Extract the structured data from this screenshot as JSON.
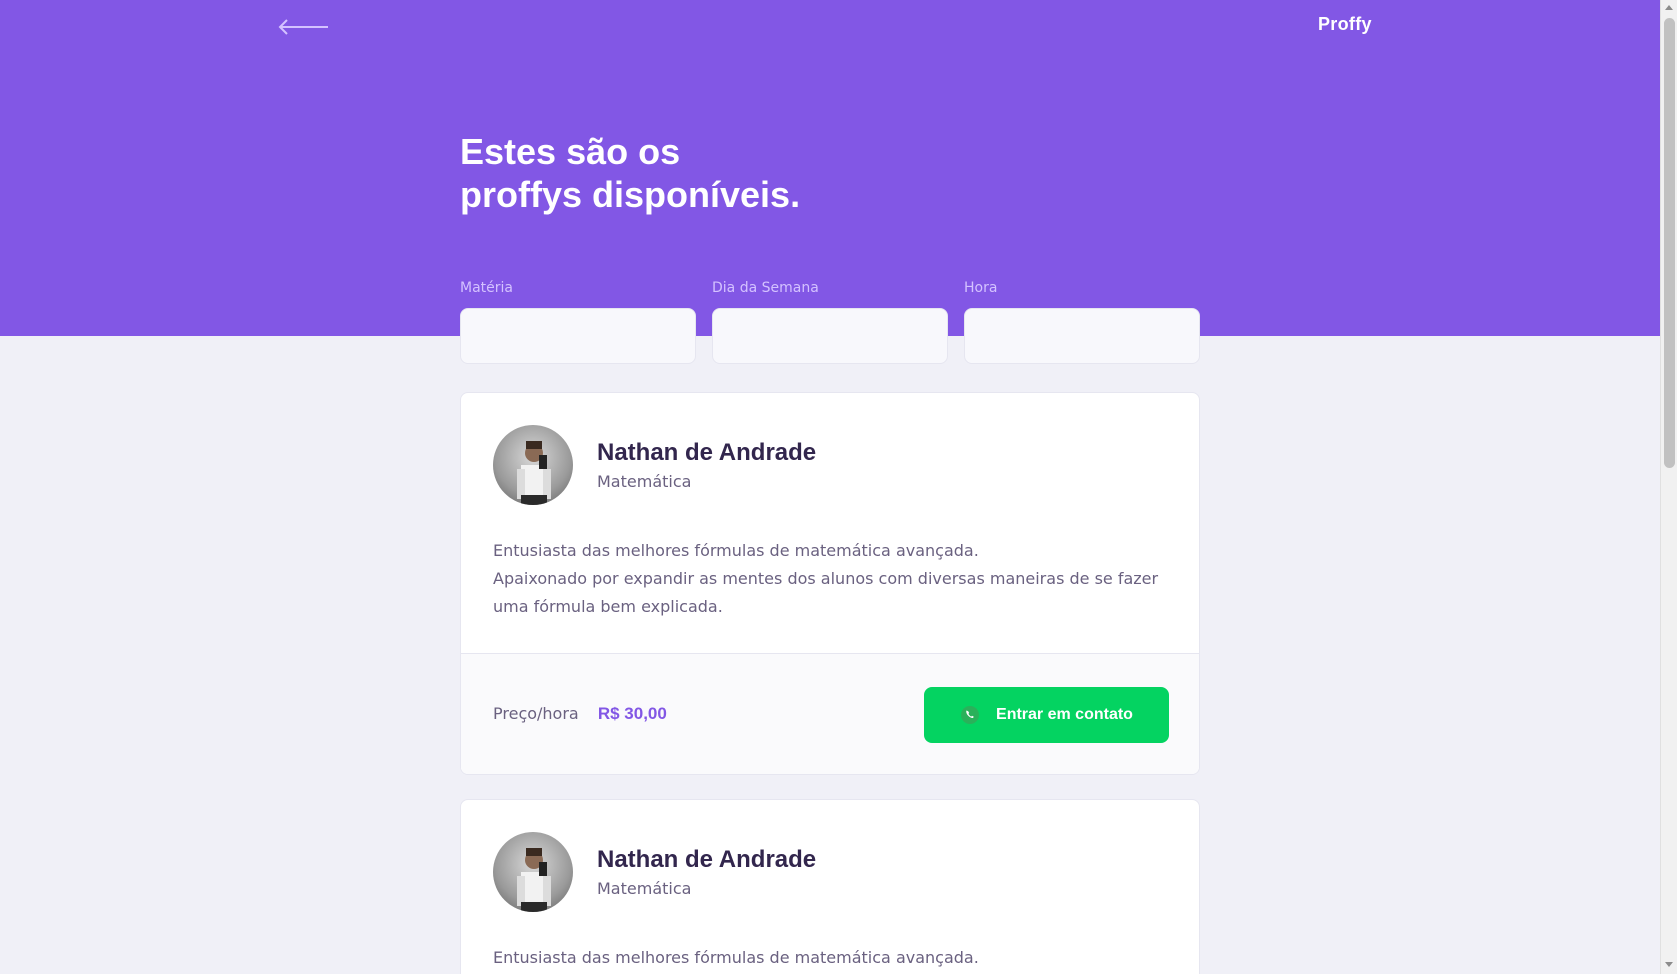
{
  "header": {
    "back_icon": "arrow-left-icon",
    "logo": "Proffy",
    "title_line1": "Estes são os",
    "title_line2": "proffys disponíveis."
  },
  "filters": [
    {
      "label": "Matéria",
      "value": ""
    },
    {
      "label": "Dia da Semana",
      "value": ""
    },
    {
      "label": "Hora",
      "value": ""
    }
  ],
  "teachers": [
    {
      "name": "Nathan de Andrade",
      "subject": "Matemática",
      "bio_line1": "Entusiasta das melhores fórmulas de matemática avançada.",
      "bio_line2": "Apaixonado por expandir as mentes dos alunos com diversas maneiras de se fazer uma fórmula bem explicada.",
      "price_label": "Preço/hora",
      "price": "R$ 30,00",
      "button": "Entrar em contato",
      "button_icon": "whatsapp-icon"
    },
    {
      "name": "Nathan de Andrade",
      "subject": "Matemática",
      "bio_line1": "Entusiasta das melhores fórmulas de matemática avançada."
    }
  ],
  "colors": {
    "primary": "#8257e5",
    "background": "#f0f0f7",
    "title_text": "#32264d",
    "body_text": "#6a6180",
    "whatsapp_green": "#04d361"
  }
}
